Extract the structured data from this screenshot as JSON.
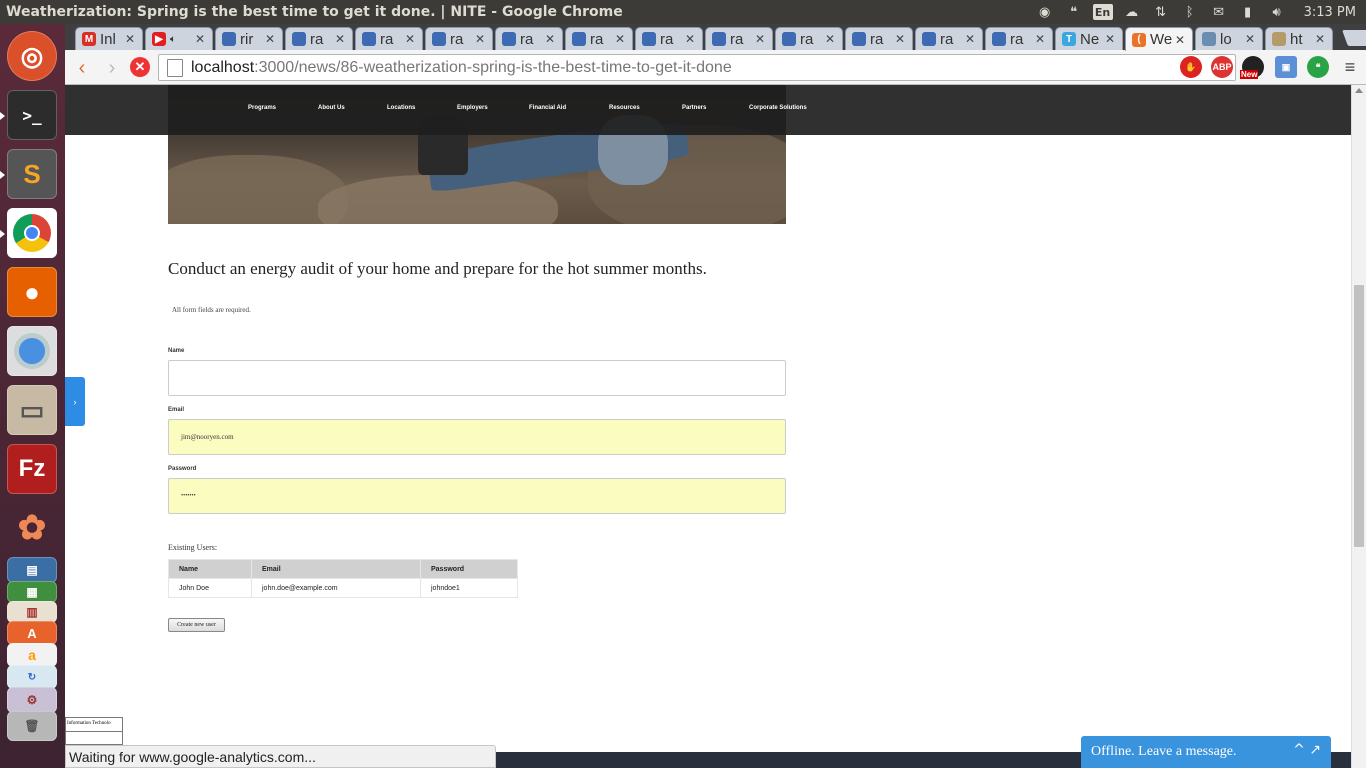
{
  "window": {
    "title": "Weatherization: Spring is the best time to get it done. | NITE - Google Chrome"
  },
  "tray": {
    "lang": "En",
    "clock": "3:13 PM"
  },
  "tabs": [
    {
      "label": "Inl",
      "color": "#d93025",
      "glyph": "M"
    },
    {
      "label": "",
      "color": "#e02020",
      "glyph": "▶"
    },
    {
      "label": "rir",
      "color": "#3d6ab3",
      "glyph": ""
    },
    {
      "label": "ra",
      "color": "#3d6ab3",
      "glyph": ""
    },
    {
      "label": "ra",
      "color": "#3d6ab3",
      "glyph": ""
    },
    {
      "label": "ra",
      "color": "#3d6ab3",
      "glyph": ""
    },
    {
      "label": "ra",
      "color": "#3d6ab3",
      "glyph": ""
    },
    {
      "label": "ra",
      "color": "#3d6ab3",
      "glyph": ""
    },
    {
      "label": "ra",
      "color": "#3d6ab3",
      "glyph": ""
    },
    {
      "label": "ra",
      "color": "#3d6ab3",
      "glyph": ""
    },
    {
      "label": "ra",
      "color": "#3d6ab3",
      "glyph": ""
    },
    {
      "label": "ra",
      "color": "#3d6ab3",
      "glyph": ""
    },
    {
      "label": "ra",
      "color": "#3d6ab3",
      "glyph": ""
    },
    {
      "label": "ra",
      "color": "#3d6ab3",
      "glyph": ""
    },
    {
      "label": "Ne",
      "color": "#3aa7e0",
      "glyph": "T"
    },
    {
      "label": "We",
      "color": "#e8742a",
      "glyph": "(",
      "active": true
    },
    {
      "label": "lo",
      "color": "#6a8db0",
      "glyph": ""
    },
    {
      "label": "ht",
      "color": "#b59a6a",
      "glyph": ""
    }
  ],
  "address": {
    "host": "localhost",
    "path": ":3000/news/86-weatherization-spring-is-the-best-time-to-get-it-done"
  },
  "extensions": {
    "abp": "ABP",
    "new_badge": "New"
  },
  "nav": [
    "Programs",
    "About Us",
    "Locations",
    "Employers",
    "Financial Aid",
    "Resources",
    "Partners",
    "Corporate Solutions"
  ],
  "headline": "Conduct an energy audit of your home and prepare for the hot summer months.",
  "form": {
    "required_note": "All form fields are required.",
    "name_label": "Name",
    "name_value": "",
    "email_label": "Email",
    "email_value": "jim@nooryen.com",
    "password_label": "Password",
    "password_value": "•••••••"
  },
  "users": {
    "heading": "Existing Users:",
    "columns": [
      "Name",
      "Email",
      "Password"
    ],
    "rows": [
      [
        "John Doe",
        "john.doe@example.com",
        "johndoe1"
      ]
    ]
  },
  "create_button": "Create new user",
  "status_text": "Waiting for www.google-analytics.com...",
  "infobox_text": "Information Technolo",
  "chat": {
    "label": "Offline. Leave a message.",
    "icons": "^ ↗"
  }
}
